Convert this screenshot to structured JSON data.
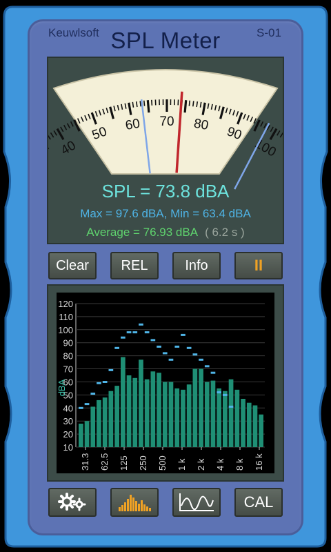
{
  "header": {
    "brand": "Keuwlsoft",
    "title": "SPL Meter",
    "model": "S-01"
  },
  "gauge": {
    "scale_labels": [
      "40",
      "50",
      "60",
      "70",
      "80",
      "90",
      "100"
    ],
    "needle_value": 73.8,
    "max_marker": 97.6,
    "min_marker": 63.4
  },
  "readout": {
    "spl": "SPL = 73.8 dBA",
    "maxmin": "Max = 97.6 dBA,  Min = 63.4 dBA",
    "average": "Average = 76.93 dBA",
    "duration": "( 6.2 s )"
  },
  "controls": {
    "clear": "Clear",
    "rel": "REL",
    "info": "Info",
    "pause": "II"
  },
  "toolbar": {
    "settings_icon": "gears-icon",
    "spectrum_icon": "bar-spectrum-icon",
    "history_icon": "waveform-icon",
    "cal": "CAL"
  },
  "colors": {
    "spl_text": "#6de3dd",
    "maxmin_text": "#4fb4e6",
    "average_text": "#5fd36e",
    "bar": "#1f8f75",
    "peak_dot": "#4fb4e6",
    "accent": "#f0a224",
    "case": "#3e95db"
  },
  "chart_data": {
    "type": "bar",
    "ylabel": "dBA",
    "ylim": [
      10,
      120
    ],
    "yticks": [
      "120",
      "110",
      "100",
      "90",
      "80",
      "70",
      "60",
      "50",
      "40",
      "30",
      "20",
      "10"
    ],
    "xticks": [
      "31.3",
      "62.5",
      "125",
      "250",
      "500",
      "1 k",
      "2 k",
      "4 k",
      "8 k",
      "16 k"
    ],
    "levels": [
      28,
      30,
      41,
      46,
      48,
      53,
      57,
      79,
      65,
      63,
      77,
      62,
      68,
      67,
      60,
      60,
      55,
      54,
      58,
      70,
      70,
      60,
      61,
      55,
      53,
      62,
      54,
      47,
      44,
      42,
      35
    ],
    "peaks": [
      40,
      43,
      51,
      59,
      60,
      69,
      86,
      94,
      98,
      98,
      104,
      98,
      92,
      87,
      82,
      77,
      87,
      96,
      86,
      81,
      77,
      72,
      67,
      52,
      50,
      41
    ]
  }
}
